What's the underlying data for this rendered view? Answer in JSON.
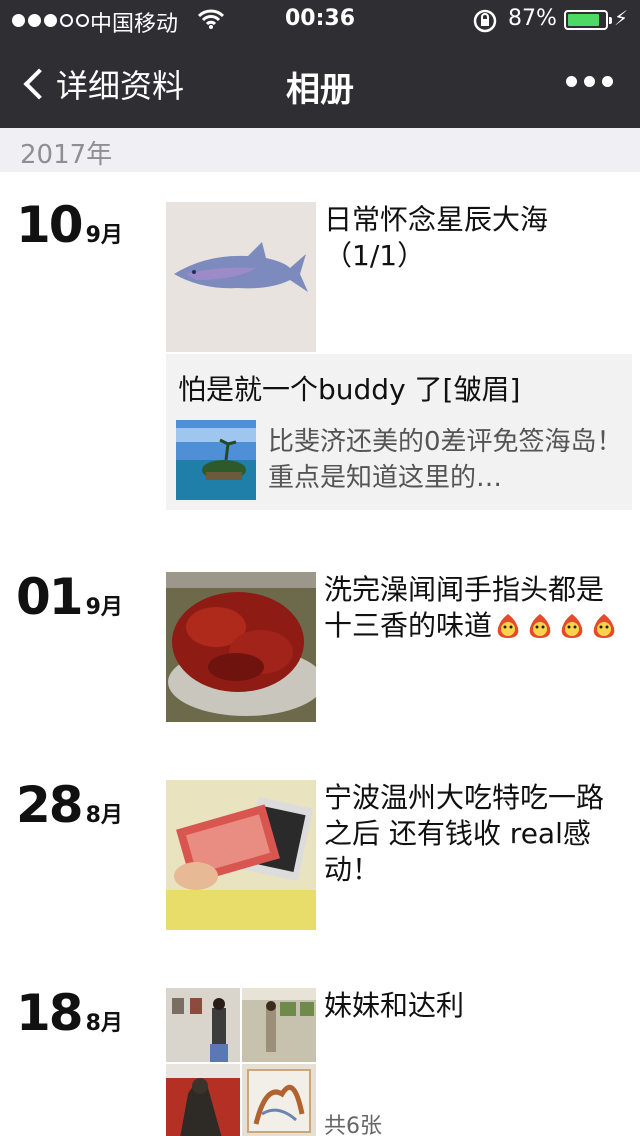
{
  "status_bar": {
    "carrier": "中国移动",
    "time": "00:36",
    "battery_percent": "87%",
    "battery_level": 0.87,
    "signal_bars": 3,
    "icons": [
      "wifi-icon",
      "rotation-lock-icon",
      "battery-icon",
      "charging-bolt-icon"
    ]
  },
  "nav": {
    "back_label": "详细资料",
    "title": "相册",
    "more_icon": "more-dots-icon"
  },
  "year": "2017年",
  "entries": [
    {
      "day": "10",
      "month": "9月",
      "caption": "日常怀念星辰大海（1/1）",
      "share": {
        "comment": "怕是就一个buddy 了[皱眉]",
        "text": "比斐济还美的0差评免签海岛！重点是知道这里的…"
      }
    },
    {
      "day": "01",
      "month": "9月",
      "caption": "洗完澡闻闻手指头都是十三香的味道"
    },
    {
      "day": "28",
      "month": "8月",
      "caption": "宁波温州大吃特吃一路之后 还有钱收 real感动！"
    },
    {
      "day": "18",
      "month": "8月",
      "caption": "妹妹和达利",
      "photo_count": "共6张"
    }
  ],
  "colors": {
    "navbar": "#2e2e33",
    "year_bar": "#efeff4",
    "battery": "#4cd964",
    "share_bg": "#f2f2f2"
  }
}
